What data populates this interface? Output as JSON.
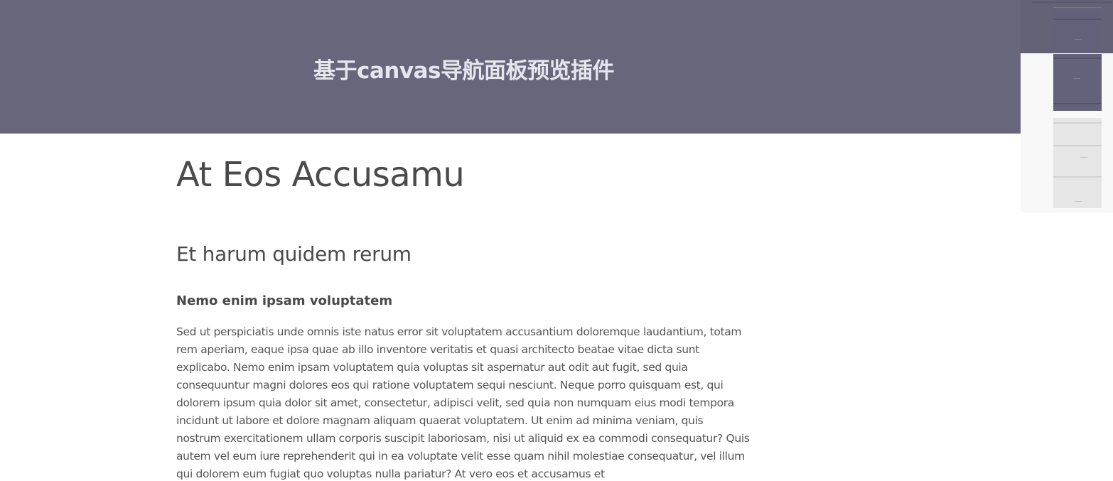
{
  "header": {
    "title": "基于canvas导航面板预览插件"
  },
  "article": {
    "h1": "At Eos Accusamu",
    "h2": "Et harum quidem rerum",
    "h3": "Nemo enim ipsam voluptatem",
    "paragraph": "Sed ut perspiciatis unde omnis iste natus error sit voluptatem accusantium doloremque laudantium, totam rem aperiam, eaque ipsa quae ab illo inventore veritatis et quasi architecto beatae vitae dicta sunt explicabo. Nemo enim ipsam voluptatem quia voluptas sit aspernatur aut odit aut fugit, sed quia consequuntur magni dolores eos qui ratione voluptatem sequi nesciunt. Neque porro quisquam est, qui dolorem ipsum quia dolor sit amet, consectetur, adipisci velit, sed quia non numquam eius modi tempora incidunt ut labore et dolore magnam aliquam quaerat voluptatem. Ut enim ad minima veniam, quis nostrum exercitationem ullam corporis suscipit laboriosam, nisi ut aliquid ex ea commodi consequatur? Quis autem vel eum iure reprehenderit qui in ea voluptate velit esse quam nihil molestiae consequatur, vel illum qui dolorem eum fugiat quo voluptas nulla pariatur? At vero eos et accusamus et"
  },
  "colors": {
    "header_bg": "#67677c",
    "header_text": "#e6e6ef",
    "body_text": "#555555",
    "minimap_bg": "#f8f8f8"
  }
}
